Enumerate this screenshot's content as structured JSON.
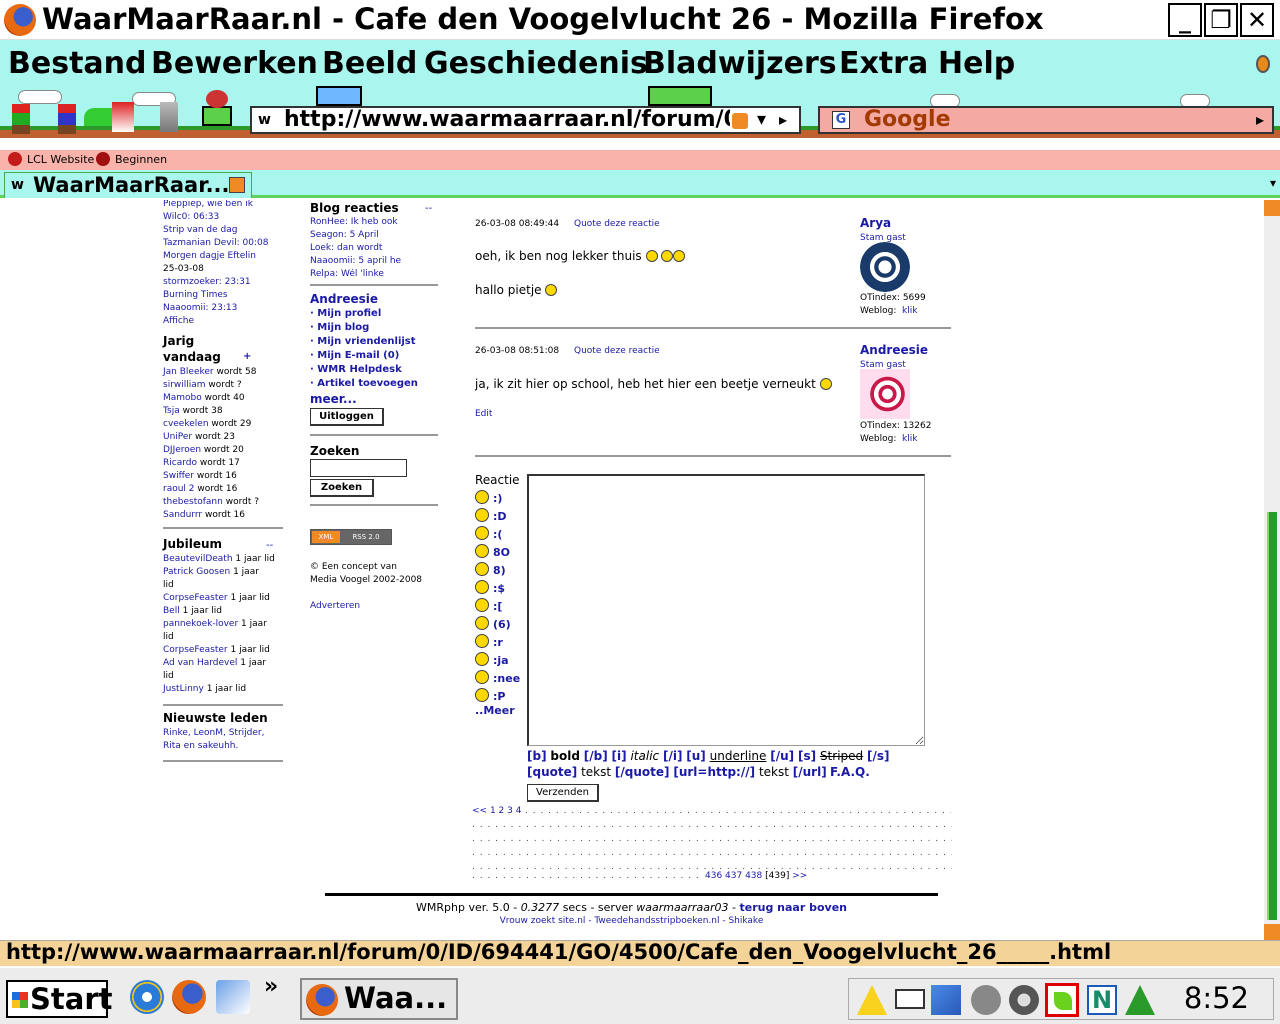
{
  "window": {
    "title": "WaarMaarRaar.nl - Cafe den Voogelvlucht 26 - Mozilla Firefox"
  },
  "menu": [
    "Bestand",
    "Bewerken",
    "Beeld",
    "Geschiedenis",
    "Bladwijzers",
    "Extra",
    "Help"
  ],
  "toolbar": {
    "url": "http://www.waarmaarraar.nl/forum/0/ID/694441/GO/4500/Cafe_den_Voogelvlucht_26_____.html",
    "search_engine": "Google",
    "favicon_glyph": "w"
  },
  "bookmarks": [
    {
      "label": "LCL Website"
    },
    {
      "label": "Beginnen"
    }
  ],
  "tab": {
    "label": "WaarMaarRaar...."
  },
  "left_column": {
    "recent_items": [
      {
        "text": "Pieppiep, wie ben ik"
      },
      {
        "text": "Wilc0: 06:33"
      },
      {
        "text": "Strip van de dag"
      },
      {
        "text": "Tazmanian Devil: 00:08"
      },
      {
        "text": "Morgen dagje Eftelin"
      },
      {
        "text": "25-03-08"
      },
      {
        "text": "stormzoeker: 23:31"
      },
      {
        "text": "Burning Times"
      },
      {
        "text": "Naaoomii: 23:13"
      },
      {
        "text": "Affiche"
      }
    ],
    "birthday_title_1": "Jarig",
    "birthday_title_2": "vandaag",
    "birthday_plus": "+",
    "birthdays": [
      {
        "name": "Jan Bleeker",
        "age": "wordt 58"
      },
      {
        "name": "sirwilliam",
        "age": "wordt ?"
      },
      {
        "name": "Mamobo",
        "age": "wordt 40"
      },
      {
        "name": "Tsja",
        "age": "wordt 38"
      },
      {
        "name": "cveekelen",
        "age": "wordt 29"
      },
      {
        "name": "UniPer",
        "age": "wordt 23"
      },
      {
        "name": "DJJeroen",
        "age": "wordt 20"
      },
      {
        "name": "Ricardo",
        "age": "wordt 17"
      },
      {
        "name": "Swiffer",
        "age": "wordt 16"
      },
      {
        "name": "raoul 2",
        "age": "wordt 16"
      },
      {
        "name": "thebestofann",
        "age": "wordt ?"
      },
      {
        "name": "Sandurrr",
        "age": "wordt 16"
      }
    ],
    "jubileum_title": "Jubileum",
    "jubileum_dash": "--",
    "jubileum": [
      {
        "name": "BeautevilDeath",
        "suffix": "1 jaar lid"
      },
      {
        "name": "Patrick Goosen",
        "suffix": "1 jaar"
      },
      {
        "name": "",
        "suffix": "lid"
      },
      {
        "name": "CorpseFeaster",
        "suffix": "1 jaar lid"
      },
      {
        "name": "Bell",
        "suffix": "1 jaar lid"
      },
      {
        "name": "pannekoek-lover",
        "suffix": "1 jaar"
      },
      {
        "name": "",
        "suffix": "lid"
      },
      {
        "name": "CorpseFeaster",
        "suffix": "1 jaar lid"
      },
      {
        "name": "Ad van Hardevel",
        "suffix": "1 jaar"
      },
      {
        "name": "",
        "suffix": "lid"
      },
      {
        "name": "JustLinny",
        "suffix": "1 jaar lid"
      }
    ],
    "newest_title": "Nieuwste leden",
    "newest_line1": "Rinke, LeonM, Strijder,",
    "newest_line2": "Rita en sakeuhh."
  },
  "middle_column": {
    "blog_title": "Blog reacties",
    "blog_dash": "--",
    "blog_items": [
      {
        "text": "RonHee: Ik heb ook"
      },
      {
        "text": "Seagon: 5 April"
      },
      {
        "text": "Loek: dan wordt"
      },
      {
        "text": "Naaoomii: 5 april he"
      },
      {
        "text": "Relpa: Wél 'linke"
      }
    ],
    "user_title": "Andreesie",
    "user_links": [
      {
        "text": "· Mijn profiel"
      },
      {
        "text": "· Mijn blog"
      },
      {
        "text": "· Mijn vriendenlijst"
      },
      {
        "text": "· Mijn E-mail (0)"
      },
      {
        "text": "· WMR Helpdesk"
      },
      {
        "text": "· Artikel toevoegen"
      }
    ],
    "more": "meer...",
    "logout_button": "Uitloggen",
    "search_title": "Zoeken",
    "search_value": "",
    "search_button": "Zoeken",
    "rss_badge_left": "XML",
    "rss_badge_right": "RSS 2.0",
    "concept_line1": "© Een concept van",
    "concept_line2": "Media Voogel 2002-2008",
    "advertise": "Adverteren"
  },
  "posts": [
    {
      "timestamp": "26-03-08 08:49:44",
      "quote_link": "Quote deze reactie",
      "line1": "oeh, ik ben nog lekker thuis",
      "line2": "hallo pietje",
      "author": "Arya",
      "rank": "Stam gast",
      "otindex": "OTindex: 5699",
      "weblog_label": "Weblog:",
      "weblog_link": "klik"
    },
    {
      "timestamp": "26-03-08 08:51:08",
      "quote_link": "Quote deze reactie",
      "line1": "ja, ik zit hier op school, heb het hier een beetje verneukt",
      "edit": "Edit",
      "author": "Andreesie",
      "rank": "Stam gast",
      "otindex": "OTindex: 13262",
      "weblog_label": "Weblog:",
      "weblog_link": "klik"
    }
  ],
  "reply": {
    "label": "Reactie",
    "smileys": [
      ":)",
      ":D",
      ":(",
      "8O",
      "8)",
      ":$",
      ":[",
      "(6)",
      ":r",
      ":ja",
      ":nee",
      ":P"
    ],
    "more": "..Meer",
    "bb_b_open": "[b]",
    "bb_bold": "bold",
    "bb_b_close": "[/b]",
    "bb_i_open": "[i]",
    "bb_italic": "italic",
    "bb_i_close": "[/i]",
    "bb_u_open": "[u]",
    "bb_underline": "underline",
    "bb_u_close": "[/u]",
    "bb_s_open": "[s]",
    "bb_striped": "Striped",
    "bb_s_close": "[/s]",
    "bb_quote_open": "[quote]",
    "bb_tekst1": "tekst",
    "bb_quote_close": "[/quote]",
    "bb_url_open": "[url=http://]",
    "bb_tekst2": "tekst",
    "bb_url_close": "[/url]",
    "faq": "F.A.Q.",
    "send_button": "Verzenden"
  },
  "pagination": {
    "prev": "<<",
    "first_pages": "1 2 3 4",
    "last_pages": "436 437 438",
    "current": "[439]",
    "next": ">>"
  },
  "footer": {
    "line1_prefix": "WMRphp ver. 5.0 -",
    "secs": "0.3277",
    "line1_mid": "secs - server",
    "server": "waarmaarraar03",
    "line1_sep": "-",
    "back_to_top": "terug naar boven",
    "line2": "Vrouw zoekt site.nl - Tweedehandsstripboeken.nl - Shikake"
  },
  "statusbar": {
    "text": "http://www.waarmaarraar.nl/forum/0/ID/694441/GO/4500/Cafe_den_Voogelvlucht_26_____.html"
  },
  "taskbar": {
    "start": "Start",
    "chevron": "»",
    "task_label": "Waa...",
    "clock": "8:52"
  },
  "colors": {
    "link": "#1a1aa6",
    "menu_bg": "#a9f6ef",
    "bookmarks_bg": "#f9b3aa",
    "status_bg": "#f3d398"
  }
}
